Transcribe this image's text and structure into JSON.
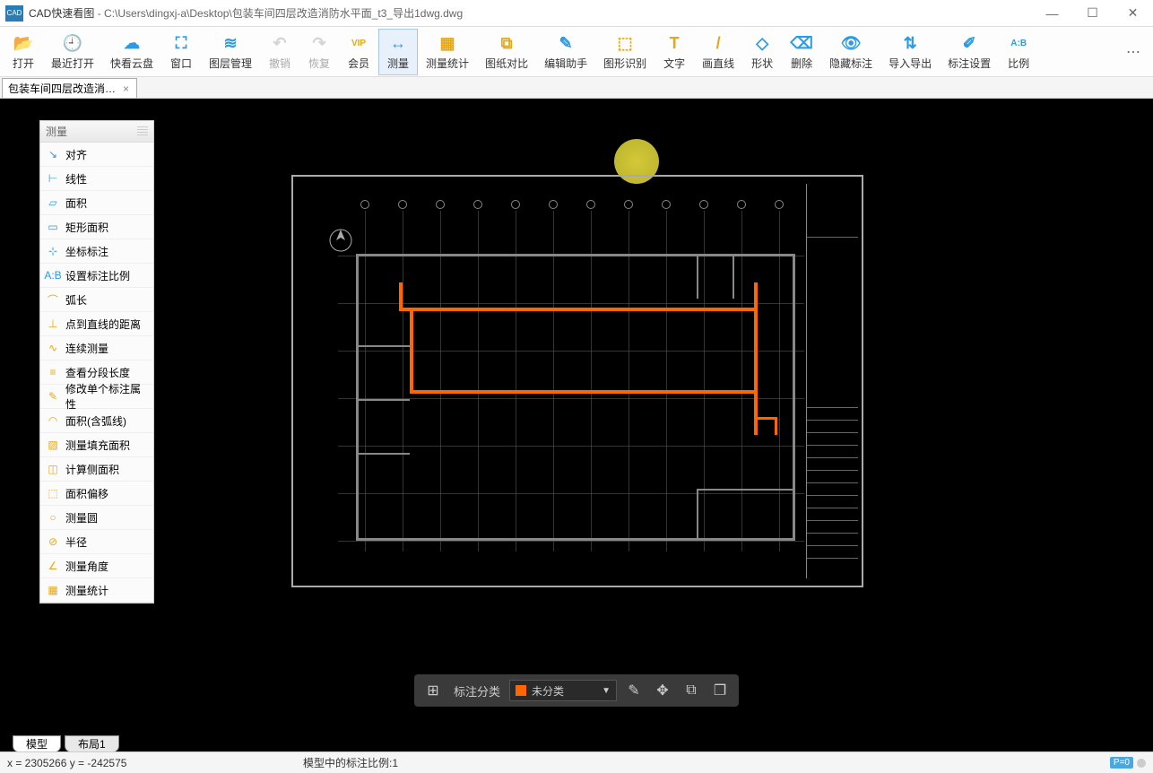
{
  "app": {
    "name": "CAD快速看图",
    "filepath": "C:\\Users\\dingxj-a\\Desktop\\包装车间四层改造消防水平面_t3_导出1dwg.dwg"
  },
  "window_controls": {
    "min": "—",
    "max": "☐",
    "close": "✕"
  },
  "toolbar": [
    {
      "id": "open",
      "label": "打开",
      "color": "#2b9be6",
      "glyph": "📂"
    },
    {
      "id": "recent",
      "label": "最近打开",
      "color": "#2b9be6",
      "glyph": "🕘"
    },
    {
      "id": "cloud",
      "label": "快看云盘",
      "color": "#2b9be6",
      "glyph": "☁"
    },
    {
      "id": "window",
      "label": "窗口",
      "color": "#2b9be6",
      "glyph": "⛶"
    },
    {
      "id": "layers",
      "label": "图层管理",
      "color": "#2b9be6",
      "glyph": "≋"
    },
    {
      "id": "undo",
      "label": "撤销",
      "color": "#999",
      "glyph": "↶",
      "disabled": true
    },
    {
      "id": "redo",
      "label": "恢复",
      "color": "#999",
      "glyph": "↷",
      "disabled": true
    },
    {
      "id": "vip",
      "label": "会员",
      "color": "#e6a817",
      "glyph": "VIP"
    },
    {
      "id": "measure",
      "label": "测量",
      "color": "#2b9be6",
      "glyph": "↔",
      "active": true
    },
    {
      "id": "stats",
      "label": "测量统计",
      "color": "#e6a817",
      "glyph": "▦"
    },
    {
      "id": "compare",
      "label": "图纸对比",
      "color": "#e6a817",
      "glyph": "⧉"
    },
    {
      "id": "edit-helper",
      "label": "编辑助手",
      "color": "#2b9be6",
      "glyph": "✎"
    },
    {
      "id": "shape-recog",
      "label": "图形识别",
      "color": "#e6a817",
      "glyph": "⬚"
    },
    {
      "id": "text",
      "label": "文字",
      "color": "#e6a817",
      "glyph": "T"
    },
    {
      "id": "line",
      "label": "画直线",
      "color": "#e6a817",
      "glyph": "/"
    },
    {
      "id": "shape",
      "label": "形状",
      "color": "#2b9be6",
      "glyph": "◇"
    },
    {
      "id": "delete",
      "label": "删除",
      "color": "#2b9be6",
      "glyph": "⌫"
    },
    {
      "id": "hide-annot",
      "label": "隐藏标注",
      "color": "#2b9be6",
      "glyph": "👁"
    },
    {
      "id": "import-export",
      "label": "导入导出",
      "color": "#2b9be6",
      "glyph": "⇅"
    },
    {
      "id": "annot-settings",
      "label": "标注设置",
      "color": "#2b9be6",
      "glyph": "✐"
    },
    {
      "id": "ratio",
      "label": "比例",
      "color": "#2b9be6",
      "glyph": "A:B"
    }
  ],
  "file_tab": {
    "label": "包装车间四层改造消…"
  },
  "side_panel": {
    "title": "测量",
    "items": [
      {
        "label": "对齐",
        "icon": "↘",
        "color": "#2b9be6"
      },
      {
        "label": "线性",
        "icon": "⊢",
        "color": "#2b9be6"
      },
      {
        "label": "面积",
        "icon": "▱",
        "color": "#2b9be6"
      },
      {
        "label": "矩形面积",
        "icon": "▭",
        "color": "#2b9be6"
      },
      {
        "label": "坐标标注",
        "icon": "⊹",
        "color": "#2b9be6"
      },
      {
        "label": "设置标注比例",
        "icon": "A:B",
        "color": "#2b9be6"
      },
      {
        "label": "弧长",
        "icon": "⌒",
        "color": "#e6a817"
      },
      {
        "label": "点到直线的距离",
        "icon": "⊥",
        "color": "#e6a817"
      },
      {
        "label": "连续测量",
        "icon": "∿",
        "color": "#e6a817"
      },
      {
        "label": "查看分段长度",
        "icon": "≡",
        "color": "#e6a817"
      },
      {
        "label": "修改单个标注属性",
        "icon": "✎",
        "color": "#e6a817"
      },
      {
        "label": "面积(含弧线)",
        "icon": "◠",
        "color": "#e6a817"
      },
      {
        "label": "测量填充面积",
        "icon": "▨",
        "color": "#e6a817"
      },
      {
        "label": "计算侧面积",
        "icon": "◫",
        "color": "#e6a817"
      },
      {
        "label": "面积偏移",
        "icon": "⬚",
        "color": "#e6a817"
      },
      {
        "label": "测量圆",
        "icon": "○",
        "color": "#e6a817"
      },
      {
        "label": "半径",
        "icon": "⊘",
        "color": "#e6a817"
      },
      {
        "label": "测量角度",
        "icon": "∠",
        "color": "#e6a817"
      },
      {
        "label": "测量统计",
        "icon": "▦",
        "color": "#e6a817"
      }
    ]
  },
  "bottom_bar": {
    "category_label": "标注分类",
    "category_value": "未分类"
  },
  "layout_tabs": [
    {
      "label": "模型",
      "active": true
    },
    {
      "label": "布局1",
      "active": false
    }
  ],
  "status": {
    "coord": "x = 2305266  y = -242575",
    "scale": "模型中的标注比例:1",
    "badge": "P=0"
  }
}
